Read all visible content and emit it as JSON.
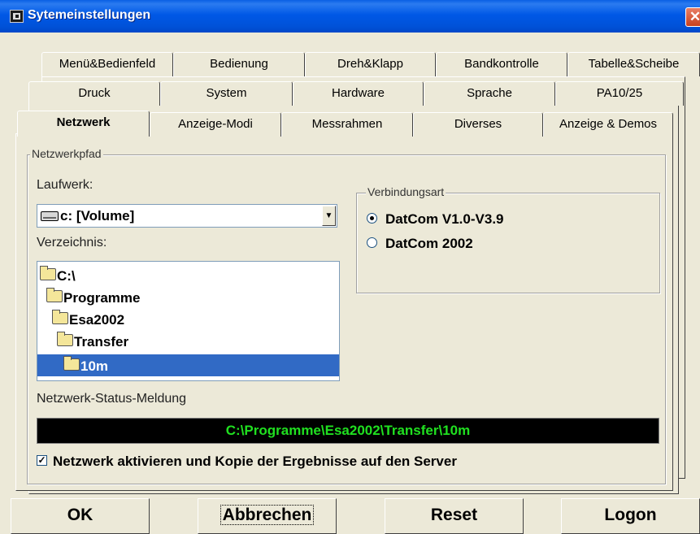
{
  "window": {
    "title": "Sytemeinstellungen",
    "close_glyph": "✕"
  },
  "tabs": {
    "row1": [
      "Menü&Bedienfeld",
      "Bedienung",
      "Dreh&Klapp",
      "Bandkontrolle",
      "Tabelle&Scheibe"
    ],
    "row2": [
      "Druck",
      "System",
      "Hardware",
      "Sprache",
      "PA10/25"
    ],
    "row3": [
      "Netzwerk",
      "Anzeige-Modi",
      "Messrahmen",
      "Diverses",
      "Anzeige & Demos"
    ],
    "active": "Netzwerk"
  },
  "netzwerk": {
    "group_label": "Netzwerkpfad",
    "drive_label": "Laufwerk:",
    "drive_value": "c: [Volume]",
    "directory_label": "Verzeichnis:",
    "directories": [
      {
        "name": "C:\\",
        "selected": false
      },
      {
        "name": "Programme",
        "selected": false
      },
      {
        "name": "Esa2002",
        "selected": false
      },
      {
        "name": "Transfer",
        "selected": false
      },
      {
        "name": "10m",
        "selected": true
      }
    ],
    "connection": {
      "label": "Verbindungsart",
      "options": [
        {
          "label": "DatCom V1.0-V3.9",
          "checked": true
        },
        {
          "label": "DatCom 2002",
          "checked": false
        }
      ]
    },
    "status_label": "Netzwerk-Status-Meldung",
    "status_text": "C:\\Programme\\Esa2002\\Transfer\\10m",
    "status_color": "#20E020",
    "activate_label": "Netzwerk aktivieren und Kopie der Ergebnisse auf den Server",
    "activate_checked": true
  },
  "buttons": {
    "ok": "OK",
    "cancel": "Abbrechen",
    "reset": "Reset",
    "logon": "Logon"
  },
  "colors": {
    "titlebar": "#0058E6",
    "selection": "#316AC5",
    "dialog_bg": "#ECE9D8"
  }
}
